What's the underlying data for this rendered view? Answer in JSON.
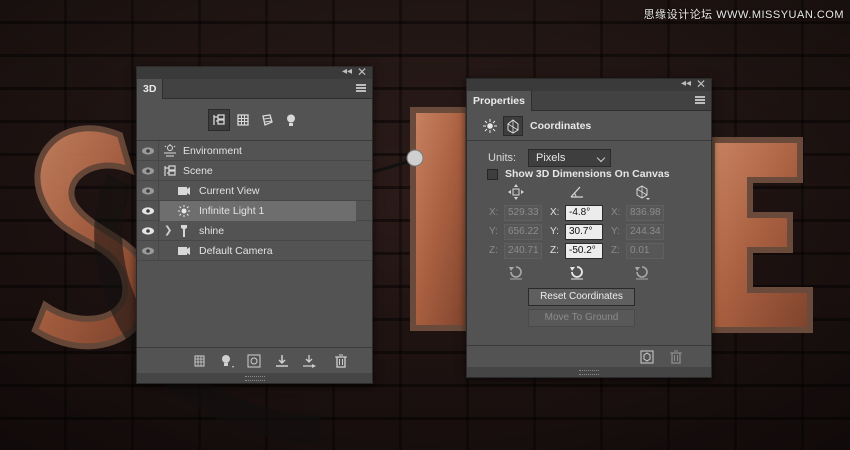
{
  "watermark": "思缘设计论坛 WWW.MISSYUAN.COM",
  "panel3d": {
    "tab": "3D",
    "collapse_glyph": "◂◂",
    "close_glyph": "✕",
    "filters": [
      {
        "name": "scene-filter-icon",
        "active": true
      },
      {
        "name": "mesh-filter-icon",
        "active": false
      },
      {
        "name": "material-filter-icon",
        "active": false
      },
      {
        "name": "light-filter-icon",
        "active": false
      }
    ],
    "layers": [
      {
        "label": "Environment",
        "icon": "environment-icon",
        "indent": 0,
        "selected": false,
        "expandable": false
      },
      {
        "label": "Scene",
        "icon": "scene-icon",
        "indent": 0,
        "selected": false,
        "expandable": false
      },
      {
        "label": "Current View",
        "icon": "camera-icon",
        "indent": 1,
        "selected": false,
        "expandable": false
      },
      {
        "label": "Infinite Light 1",
        "icon": "infinite-light-icon",
        "indent": 1,
        "selected": true,
        "expandable": false
      },
      {
        "label": "shine",
        "icon": "mesh-icon",
        "indent": 0,
        "selected": false,
        "expandable": true
      },
      {
        "label": "Default Camera",
        "icon": "camera-icon",
        "indent": 1,
        "selected": false,
        "expandable": false
      }
    ],
    "expand_glyph": "❯"
  },
  "properties": {
    "tab": "Properties",
    "collapse_glyph": "◂◂",
    "close_glyph": "✕",
    "section_title": "Coordinates",
    "units_label": "Units:",
    "units_value": "Pixels",
    "show_dims_label": "Show 3D Dimensions On Canvas",
    "columns": [
      {
        "icon": "position-icon",
        "rows": [
          {
            "axis": "X:",
            "value": "529.33",
            "enabled": false
          },
          {
            "axis": "Y:",
            "value": "656.22",
            "enabled": false
          },
          {
            "axis": "Z:",
            "value": "240.71",
            "enabled": false
          }
        ]
      },
      {
        "icon": "rotation-icon",
        "rows": [
          {
            "axis": "X:",
            "value": "-4.8°",
            "enabled": true
          },
          {
            "axis": "Y:",
            "value": "30.7°",
            "enabled": true
          },
          {
            "axis": "Z:",
            "value": "-50.2°",
            "enabled": true
          }
        ]
      },
      {
        "icon": "scale-icon",
        "rows": [
          {
            "axis": "X:",
            "value": "836.98",
            "enabled": false
          },
          {
            "axis": "Y:",
            "value": "244.34",
            "enabled": false
          },
          {
            "axis": "Z:",
            "value": "0.01",
            "enabled": false
          }
        ]
      }
    ],
    "reset_button": "Reset Coordinates",
    "ground_button": "Move To Ground"
  },
  "colors": {
    "panel_bg": "#535353",
    "selected_row": "#6e6e6e",
    "copper": "#b4694a"
  }
}
